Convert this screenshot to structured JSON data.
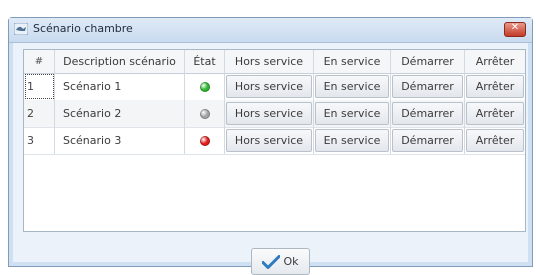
{
  "window": {
    "title": "Scénario chambre",
    "close_label": "✕"
  },
  "table": {
    "headers": {
      "num": "#",
      "description": "Description scénario",
      "state": "État",
      "out_of_service": "Hors service",
      "in_service": "En service",
      "start": "Démarrer",
      "stop": "Arrêter"
    },
    "rows": [
      {
        "num": "1",
        "description": "Scénario 1",
        "state": "green"
      },
      {
        "num": "2",
        "description": "Scénario 2",
        "state": "gray"
      },
      {
        "num": "3",
        "description": "Scénario 3",
        "state": "red"
      }
    ],
    "actions": {
      "out_of_service": "Hors service",
      "in_service": "En service",
      "start": "Démarrer",
      "stop": "Arrêter"
    }
  },
  "ok_button": {
    "label": "Ok",
    "icon": "checkmark-icon"
  },
  "colors": {
    "green": "#2fb52f",
    "gray": "#a3a3a3",
    "red": "#e11b1b",
    "accent": "#2e7bbf"
  }
}
